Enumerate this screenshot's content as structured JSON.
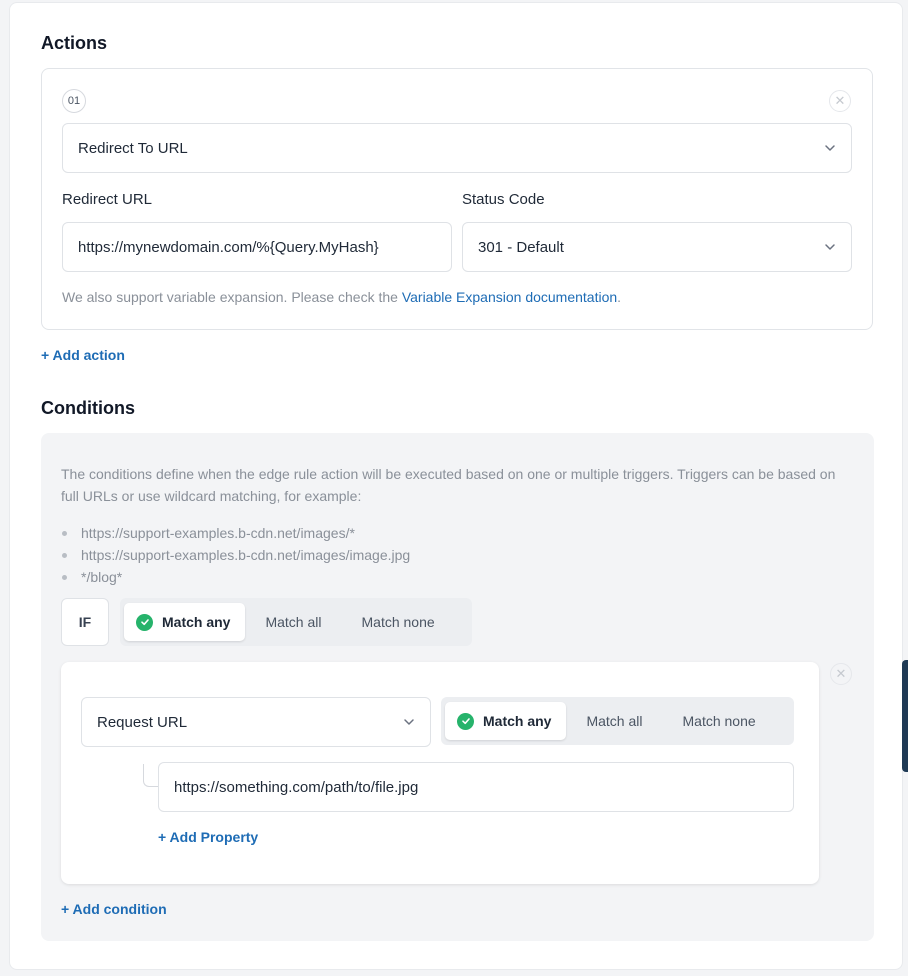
{
  "actions": {
    "title": "Actions",
    "items": [
      {
        "index": "01",
        "type": "Redirect To URL",
        "redirect_url_label": "Redirect URL",
        "redirect_url_value": "https://mynewdomain.com/%{Query.MyHash}",
        "status_code_label": "Status Code",
        "status_code_value": "301 - Default",
        "hint_text": "We also support variable expansion. Please check the ",
        "hint_link": "Variable Expansion documentation",
        "hint_end": "."
      }
    ],
    "add_action": "+ Add action"
  },
  "conditions": {
    "title": "Conditions",
    "description": "The conditions define when the edge rule action will be executed based on one or multiple triggers. Triggers can be based on full URLs or use wildcard matching, for example:",
    "examples": [
      "https://support-examples.b-cdn.net/images/*",
      "https://support-examples.b-cdn.net/images/image.jpg",
      "*/blog*"
    ],
    "if_label": "IF",
    "match_options": [
      "Match any",
      "Match all",
      "Match none"
    ],
    "match_selected": "Match any",
    "triggers": [
      {
        "type": "Request URL",
        "match_options": [
          "Match any",
          "Match all",
          "Match none"
        ],
        "match_selected": "Match any",
        "values": [
          "https://something.com/path/to/file.jpg"
        ],
        "add_property": "+ Add Property"
      }
    ],
    "add_condition": "+ Add condition"
  },
  "colors": {
    "accent": "#1e6cb5",
    "success": "#26b36b"
  }
}
